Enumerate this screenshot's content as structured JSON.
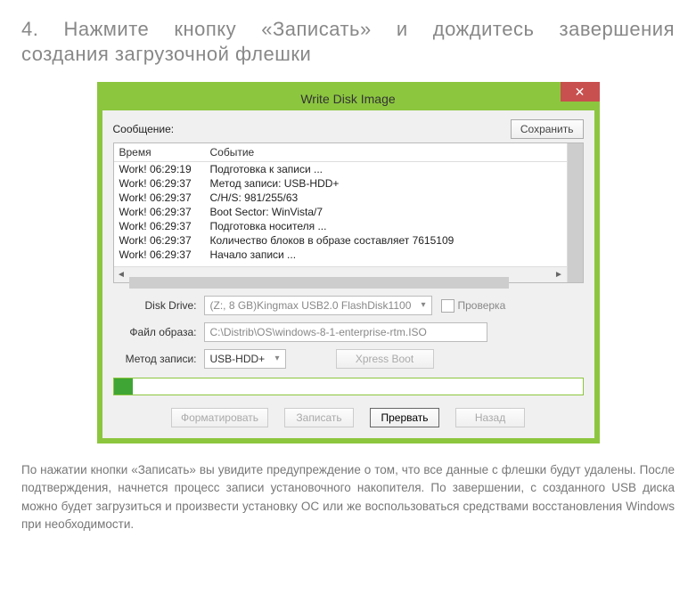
{
  "heading_line1": "4. Нажмите кнопку «Записать» и дождитесь завершения",
  "heading_line2": "создания загрузочной флешки",
  "dialog": {
    "title": "Write Disk Image",
    "msg_label": "Сообщение:",
    "save_btn": "Сохранить",
    "col_time": "Время",
    "col_event": "Событие",
    "log": [
      {
        "time": "Work! 06:29:19",
        "event": "Подготовка к записи ..."
      },
      {
        "time": "Work! 06:29:37",
        "event": "Метод записи: USB-HDD+"
      },
      {
        "time": "Work! 06:29:37",
        "event": "C/H/S: 981/255/63"
      },
      {
        "time": "Work! 06:29:37",
        "event": "Boot Sector: WinVista/7"
      },
      {
        "time": "Work! 06:29:37",
        "event": "Подготовка носителя ..."
      },
      {
        "time": "Work! 06:29:37",
        "event": "Количество блоков в образе составляет 7615109"
      },
      {
        "time": "Work! 06:29:37",
        "event": "Начало записи ..."
      }
    ],
    "disk_drive_label": "Disk Drive:",
    "disk_drive_value": "(Z:, 8 GB)Kingmax USB2.0 FlashDisk1100",
    "check_label": "Проверка",
    "file_image_label": "Файл образа:",
    "file_image_value": "C:\\Distrib\\OS\\windows-8-1-enterprise-rtm.ISO",
    "method_label": "Метод записи:",
    "method_value": "USB-HDD+",
    "xpress_btn": "Xpress Boot",
    "format_btn": "Форматировать",
    "write_btn": "Записать",
    "abort_btn": "Прервать",
    "back_btn": "Назад"
  },
  "footer": "По нажатии кнопки «Записать» вы увидите предупреждение о том, что все данные с флешки будут удалены. После подтверждения, начнется процесс записи установочного накопителя. По завершении, с созданного USB диска можно будет загрузиться и произвести установку ОС или же воспользоваться средствами восстановления Windows при необходимости."
}
